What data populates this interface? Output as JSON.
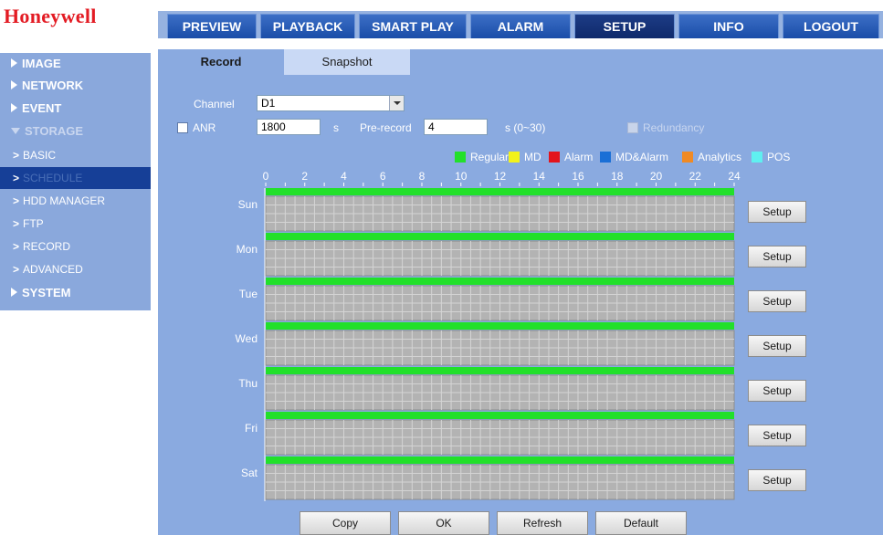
{
  "brand": {
    "logo": "Honeywell"
  },
  "nav": {
    "tabs": [
      {
        "label": "PREVIEW"
      },
      {
        "label": "PLAYBACK"
      },
      {
        "label": "SMART PLAY"
      },
      {
        "label": "ALARM"
      },
      {
        "label": "SETUP"
      },
      {
        "label": "INFO"
      },
      {
        "label": "LOGOUT"
      }
    ],
    "active": "SETUP"
  },
  "sidebar": {
    "sections": [
      {
        "label": "IMAGE",
        "expanded": false
      },
      {
        "label": "NETWORK",
        "expanded": false
      },
      {
        "label": "EVENT",
        "expanded": false
      },
      {
        "label": "STORAGE",
        "expanded": true
      },
      {
        "label": "SYSTEM",
        "expanded": false
      }
    ],
    "storage_items": [
      {
        "label": "BASIC"
      },
      {
        "label": "SCHEDULE"
      },
      {
        "label": "HDD MANAGER"
      },
      {
        "label": "FTP"
      },
      {
        "label": "RECORD"
      },
      {
        "label": "ADVANCED"
      }
    ],
    "active_item": "SCHEDULE",
    "chevron": ">"
  },
  "subtabs": [
    {
      "label": "Record",
      "active": true
    },
    {
      "label": "Snapshot",
      "active": false
    }
  ],
  "form": {
    "channel_label": "Channel",
    "channel_value": "D1",
    "anr_label": "ANR",
    "anr_checked": false,
    "anr_value": "1800",
    "anr_unit": "s",
    "prerecord_label": "Pre-record",
    "prerecord_value": "4",
    "prerecord_unit": "s (0~30)",
    "redundancy_label": "Redundancy",
    "redundancy_enabled": false
  },
  "legend": [
    {
      "label": "Regular",
      "color": "#22e02a"
    },
    {
      "label": "MD",
      "color": "#f2f21a"
    },
    {
      "label": "Alarm",
      "color": "#e3141c"
    },
    {
      "label": "MD&Alarm",
      "color": "#1a6fd6"
    },
    {
      "label": "Analytics",
      "color": "#f08a24"
    },
    {
      "label": "POS",
      "color": "#5ff0f0"
    }
  ],
  "chart_data": {
    "type": "schedule-timeline",
    "x_ticks": [
      "0",
      "2",
      "4",
      "6",
      "8",
      "10",
      "12",
      "14",
      "16",
      "18",
      "20",
      "22",
      "24"
    ],
    "xlim": [
      0,
      24
    ],
    "days": [
      {
        "name": "Sun",
        "segments": [
          {
            "type": "Regular",
            "start": 0,
            "end": 24
          }
        ]
      },
      {
        "name": "Mon",
        "segments": [
          {
            "type": "Regular",
            "start": 0,
            "end": 24
          }
        ]
      },
      {
        "name": "Tue",
        "segments": [
          {
            "type": "Regular",
            "start": 0,
            "end": 24
          }
        ]
      },
      {
        "name": "Wed",
        "segments": [
          {
            "type": "Regular",
            "start": 0,
            "end": 24
          }
        ]
      },
      {
        "name": "Thu",
        "segments": [
          {
            "type": "Regular",
            "start": 0,
            "end": 24
          }
        ]
      },
      {
        "name": "Fri",
        "segments": [
          {
            "type": "Regular",
            "start": 0,
            "end": 24
          }
        ]
      },
      {
        "name": "Sat",
        "segments": [
          {
            "type": "Regular",
            "start": 0,
            "end": 24
          }
        ]
      }
    ]
  },
  "setup_button_label": "Setup",
  "buttons": {
    "copy": "Copy",
    "ok": "OK",
    "refresh": "Refresh",
    "default": "Default"
  }
}
